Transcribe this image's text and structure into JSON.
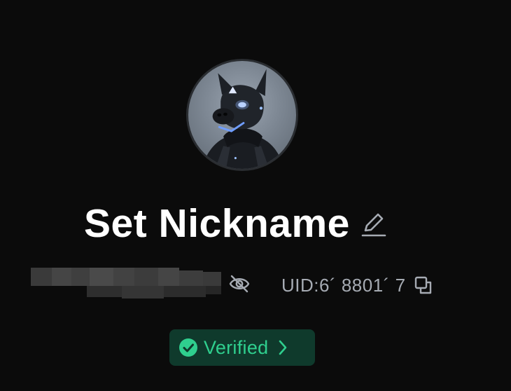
{
  "profile": {
    "nickname": "Set Nickname",
    "uid_label": "UID:6´ 8801´ 7",
    "verified_label": "Verified"
  },
  "icons": {
    "edit": "pencil-icon",
    "visibility": "eye-off-icon",
    "copy": "copy-icon",
    "verified": "check-circle-icon",
    "chevron": "chevron-right-icon"
  },
  "colors": {
    "background": "#0b0b0b",
    "verified_bg": "#0f3a2c",
    "verified_text": "#2fcf8e",
    "muted_text": "#a6abb3"
  }
}
